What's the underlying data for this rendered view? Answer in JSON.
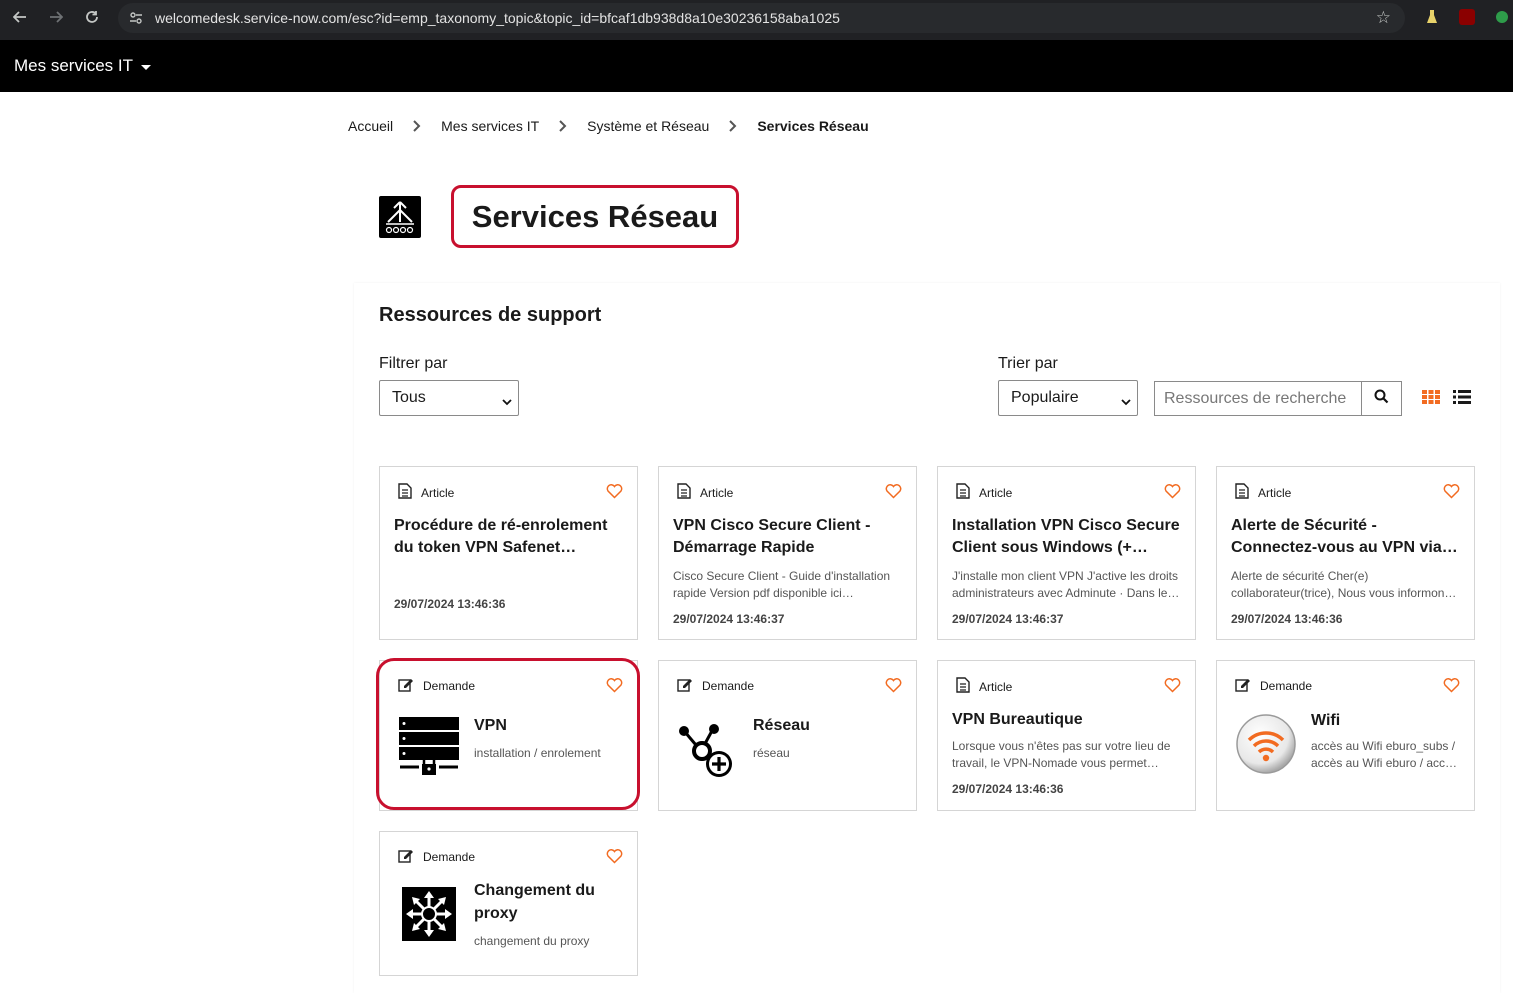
{
  "browser": {
    "url": "welcomedesk.service-now.com/esc?id=emp_taxonomy_topic&topic_id=bfcaf1db938d8a10e30236158aba1025"
  },
  "topnav": {
    "title": "Mes services IT"
  },
  "breadcrumb": [
    "Accueil",
    "Mes services IT",
    "Système et Réseau",
    "Services Réseau"
  ],
  "page": {
    "title": "Services Réseau"
  },
  "resources": {
    "heading": "Ressources de support",
    "filter_label": "Filtrer par",
    "filter_value": "Tous",
    "sort_label": "Trier par",
    "sort_value": "Populaire",
    "search_placeholder": "Ressources de recherche"
  },
  "colors": {
    "accent": "#f26b21",
    "highlight": "#c8102e"
  },
  "cards": [
    {
      "type": "Article",
      "title": "Procédure de ré-enrolement du token VPN Safenet…",
      "desc": "",
      "date": "29/07/2024 13:46:36"
    },
    {
      "type": "Article",
      "title": "VPN Cisco Secure Client - Démarrage Rapide",
      "desc": "Cisco Secure Client - Guide d'installation rapide Version pdf disponible ici…",
      "date": "29/07/2024 13:46:37"
    },
    {
      "type": "Article",
      "title": "Installation VPN Cisco Secure Client sous Windows (+…",
      "desc": "J'installe mon client VPN J'active les droits administrateurs avec Adminute · Dans le…",
      "date": "29/07/2024 13:46:37"
    },
    {
      "type": "Article",
      "title": "Alerte de Sécurité - Connectez-vous au VPN via…",
      "desc": "Alerte de sécurité Cher(e) collaborateur(trice), Nous vous informon…",
      "date": "29/07/2024 13:46:36"
    },
    {
      "type": "Demande",
      "title": "VPN",
      "desc": "installation / enrolement",
      "icon": "server-lock-icon"
    },
    {
      "type": "Demande",
      "title": "Réseau",
      "desc": "réseau",
      "icon": "network-add-icon"
    },
    {
      "type": "Article",
      "title": "VPN Bureautique",
      "desc": "Lorsque vous n'êtes pas sur votre lieu de travail, le VPN-Nomade vous permet…",
      "date": "29/07/2024 13:46:36"
    },
    {
      "type": "Demande",
      "title": "Wifi",
      "desc": "accès au Wifi eburo_subs / accès au Wifi eburo / acc…",
      "icon": "wifi-icon"
    },
    {
      "type": "Demande",
      "title": "Changement du proxy",
      "desc": "changement du proxy",
      "icon": "proxy-switch-icon"
    }
  ]
}
